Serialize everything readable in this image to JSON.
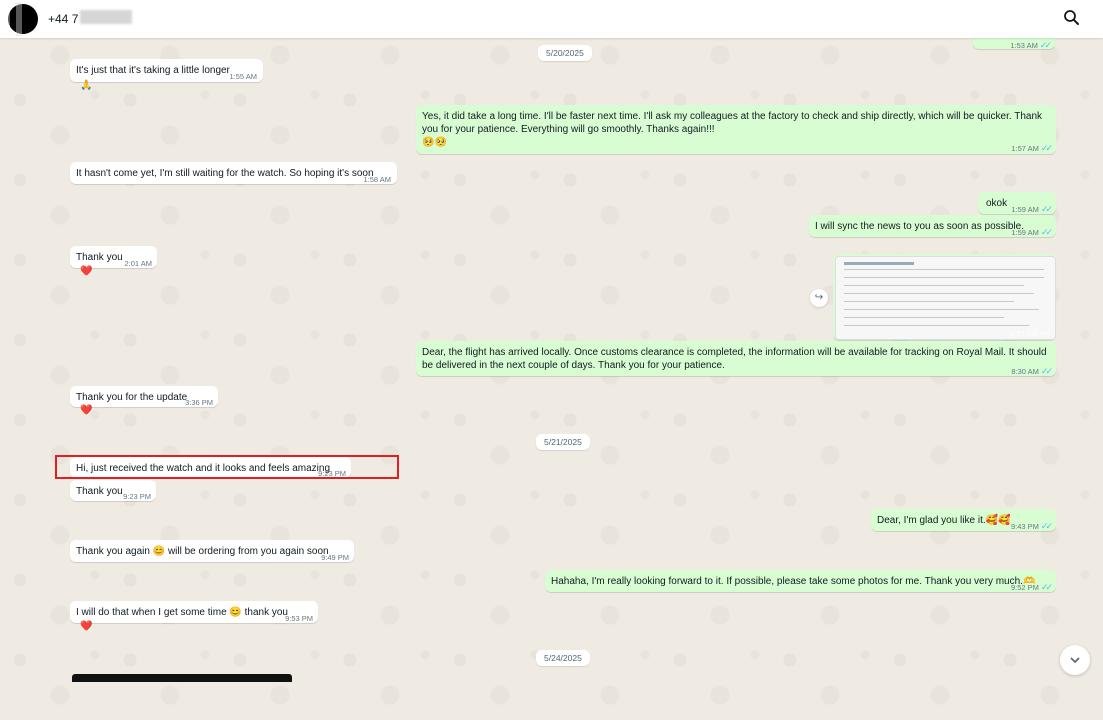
{
  "header": {
    "contact_name": "+44 7",
    "search_icon": "search-icon"
  },
  "dates": [
    "5/20/2025",
    "5/21/2025",
    "5/24/2025"
  ],
  "messages": [
    {
      "dir": "out",
      "text": "",
      "time": "1:53 AM"
    },
    {
      "dir": "in",
      "text": "It's just that it's taking a little longer",
      "time": "1:55 AM",
      "reaction": "🙏"
    },
    {
      "dir": "out",
      "text": "Yes, it did take a long time. I'll be faster next time. I'll ask my colleagues at the factory to check and ship directly, which will be quicker. Thank you for your patience. Everything will go smoothly. Thanks again!!!",
      "emoji": "🥺🥺",
      "time": "1:57 AM"
    },
    {
      "dir": "in",
      "text": "It hasn't come yet, I'm still waiting for the watch. So hoping it's soon",
      "time": "1:58 AM"
    },
    {
      "dir": "out",
      "text": "okok",
      "time": "1:59 AM"
    },
    {
      "dir": "out",
      "text": "I will sync the news to you as soon as possible.",
      "time": "1:59 AM"
    },
    {
      "dir": "in",
      "text": "Thank you",
      "time": "2:01 AM",
      "reaction": "❤️"
    },
    {
      "dir": "out",
      "text": "",
      "time": "8:27 AM",
      "type": "image"
    },
    {
      "dir": "out",
      "text": "Dear, the flight has arrived locally. Once customs clearance is completed, the information will be available for tracking on Royal Mail. It should be delivered in the next couple of days. Thank you for your patience.",
      "time": "8:30 AM"
    },
    {
      "dir": "in",
      "text": "Thank you for the update",
      "time": "3:36 PM",
      "reaction": "❤️"
    },
    {
      "dir": "in",
      "text": "Hi, just received the watch and it looks and feels amazing",
      "time": "9:23 PM"
    },
    {
      "dir": "in",
      "text": "Thank you",
      "time": "9:23 PM"
    },
    {
      "dir": "out",
      "text": "Dear, I'm glad you like it.🥰🥰",
      "time": "9:43 PM"
    },
    {
      "dir": "in",
      "text": "Thank you again 😊 will be ordering from you again soon",
      "time": "9:49 PM"
    },
    {
      "dir": "out",
      "text": "Hahaha, I'm really looking forward to it. If possible, please take some photos for me. Thank you very much.🫶",
      "time": "9:52 PM"
    },
    {
      "dir": "in",
      "text": "I will do that when I get some time 😊 thank you",
      "time": "9:53 PM",
      "reaction": "❤️"
    }
  ],
  "ticks": "✓✓",
  "colors": {
    "incoming": "#ffffff",
    "outgoing": "#d9fdd3",
    "background": "#efeae2",
    "read_ticks": "#53bdeb",
    "highlight": "#e02020"
  }
}
